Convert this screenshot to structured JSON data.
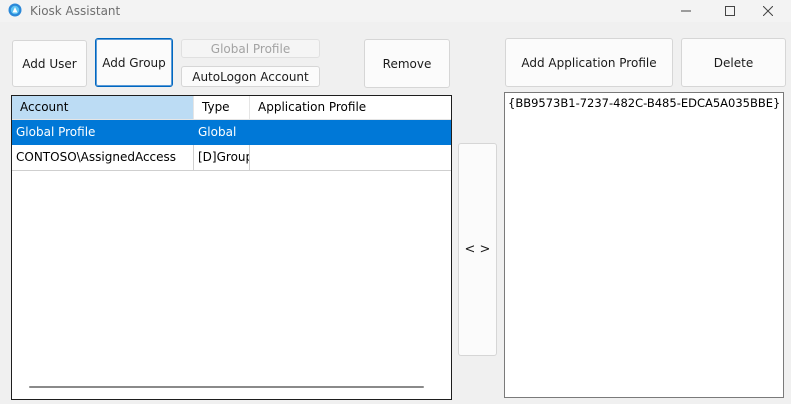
{
  "window": {
    "title": "Kiosk Assistant",
    "app_icon": "kiosk-app-icon",
    "controls": [
      "minimize-icon",
      "maximize-icon",
      "close-icon"
    ]
  },
  "toolbar": {
    "add_user": "Add User",
    "add_group": "Add Group",
    "global_profile": "Global Profile",
    "autologon_account": "AutoLogon Account",
    "remove": "Remove",
    "add_application_profile": "Add Application Profile",
    "delete": "Delete"
  },
  "accounts_table": {
    "columns": [
      "Account",
      "Type",
      "Application Profile"
    ],
    "rows": [
      {
        "account": "Global Profile",
        "type": "Global",
        "profile": "",
        "selected": true
      },
      {
        "account": "CONTOSO\\AssignedAccess",
        "type": "[D]Group",
        "profile": "",
        "selected": false
      }
    ]
  },
  "assign_button": "< >",
  "application_profiles": [
    "{BB9573B1-7237-482C-B485-EDCA5A035BBE}"
  ],
  "colors": {
    "selection": "#0078d7",
    "sorted_header": "#bcdcf4",
    "focus_border": "#0067c0"
  }
}
